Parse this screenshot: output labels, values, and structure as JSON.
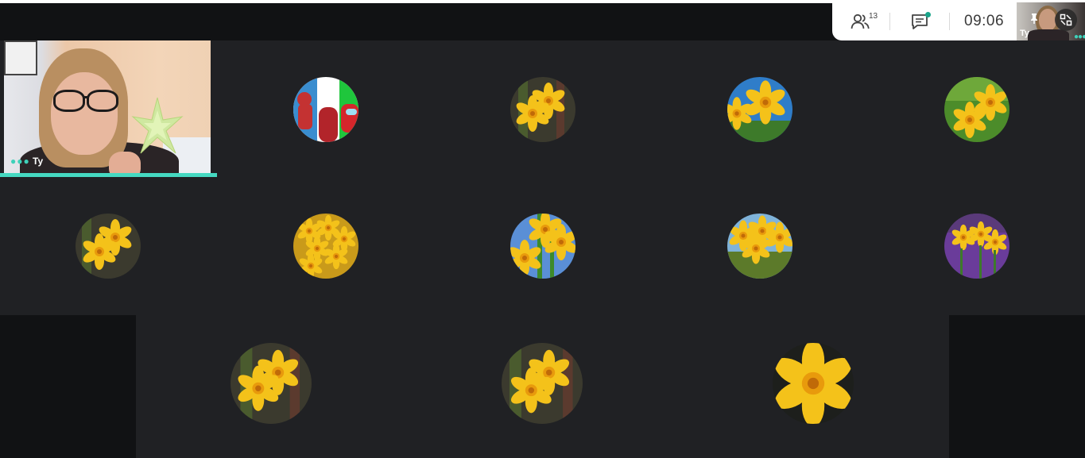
{
  "toolbar": {
    "participants_icon": "people-icon",
    "participants_count": "13",
    "chat_icon": "chat-icon",
    "chat_unread_color": "#1aa58b",
    "clock": "09:06"
  },
  "self_preview": {
    "label": "Ty",
    "pin_icon": "pin-icon",
    "minimize_icon": "minimize-icon"
  },
  "main_video": {
    "label": "Ty",
    "speaking_color": "#45d9c1",
    "more_icon": "more-dots-icon"
  },
  "participants": [
    {
      "avatar": "among-us-teletubbies"
    },
    {
      "avatar": "daffodils-dark"
    },
    {
      "avatar": "daffodils-blue-sky"
    },
    {
      "avatar": "daffodils-green"
    },
    {
      "avatar": "daffodils-dark"
    },
    {
      "avatar": "daffodils-bunch"
    },
    {
      "avatar": "daffodils-blue-sky"
    },
    {
      "avatar": "daffodils-field"
    },
    {
      "avatar": "daffodils-purple"
    },
    {
      "avatar": "daffodils-dark"
    },
    {
      "avatar": "daffodils-dark"
    },
    {
      "avatar": "daffodil-single"
    }
  ]
}
